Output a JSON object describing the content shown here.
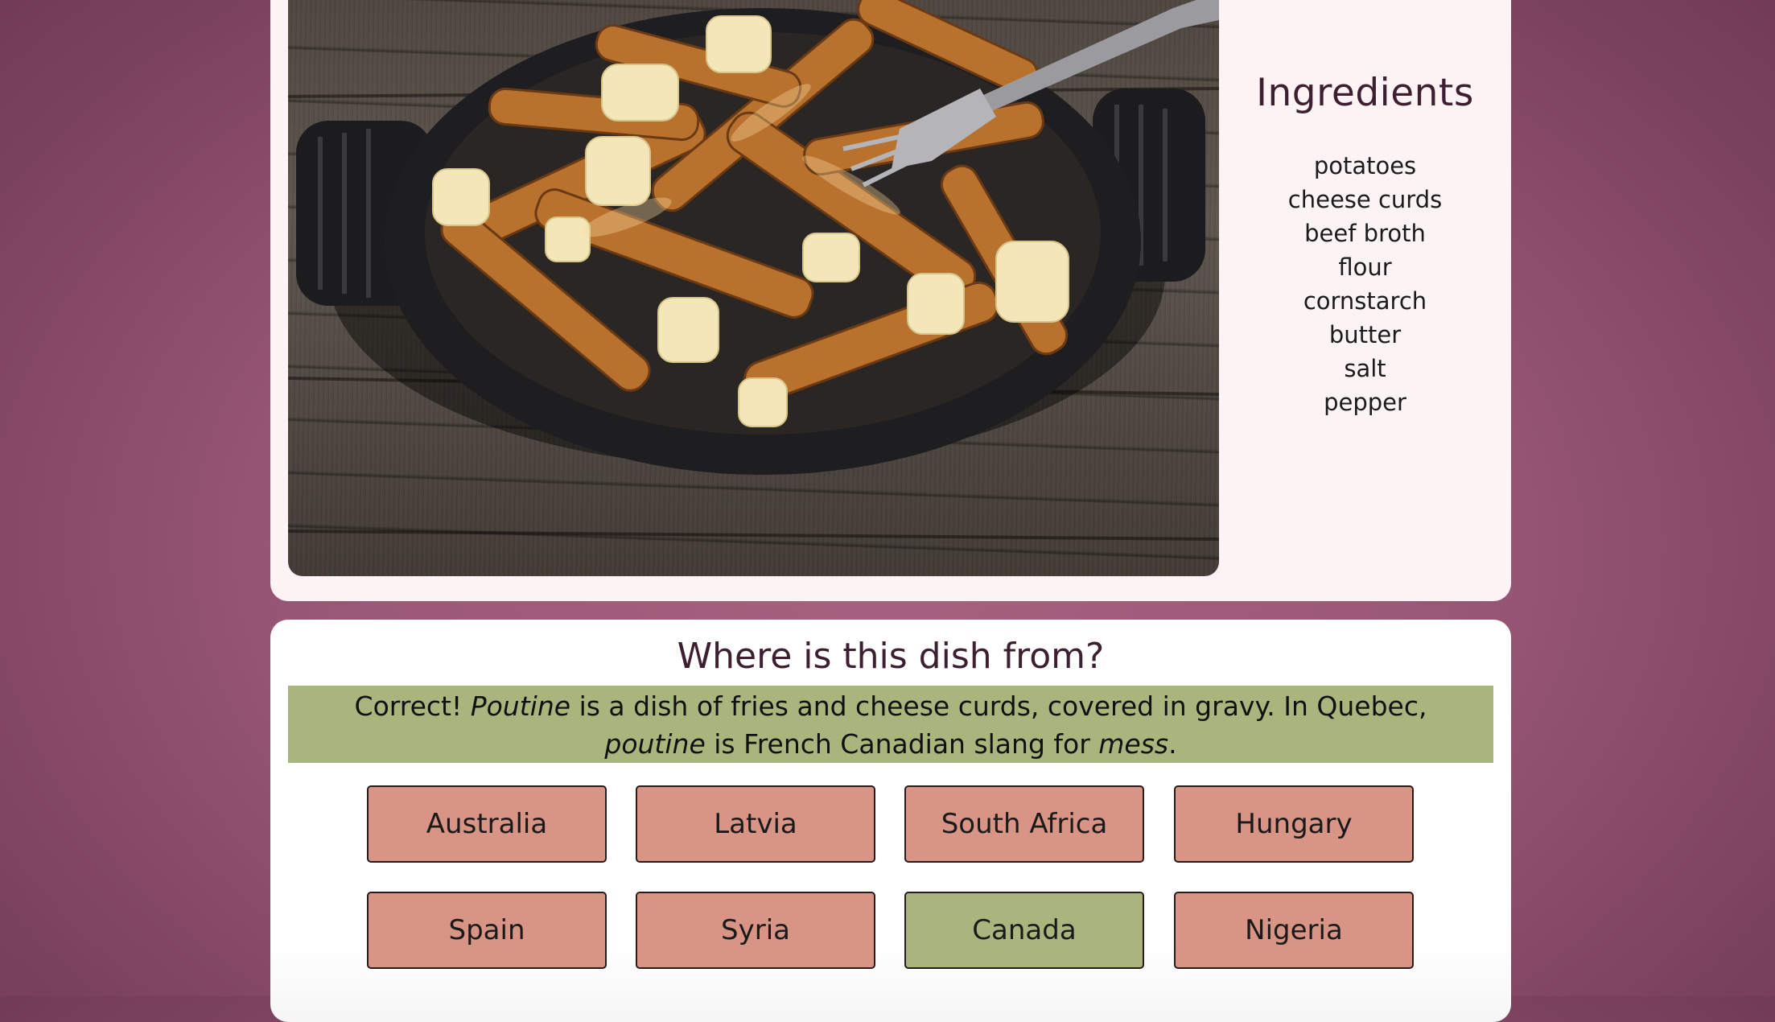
{
  "ingredients": {
    "title": "Ingredients",
    "items": [
      "potatoes",
      "cheese curds",
      "beef broth",
      "flour",
      "cornstarch",
      "butter",
      "salt",
      "pepper"
    ]
  },
  "quiz": {
    "question": "Where is this dish from?",
    "feedback": {
      "correct_label": "Correct!",
      "dish_name": "Poutine",
      "text_1": "is a dish of fries and cheese curds, covered in gravy. In Quebec,",
      "dish_name_lower": "poutine",
      "text_2": "is French Canadian slang for",
      "slang_word": "mess",
      "end": "."
    },
    "answers": [
      {
        "label": "Australia",
        "state": "wrong"
      },
      {
        "label": "Latvia",
        "state": "wrong"
      },
      {
        "label": "South Africa",
        "state": "wrong"
      },
      {
        "label": "Hungary",
        "state": "wrong"
      },
      {
        "label": "Spain",
        "state": "wrong"
      },
      {
        "label": "Syria",
        "state": "wrong"
      },
      {
        "label": "Canada",
        "state": "correct"
      },
      {
        "label": "Nigeria",
        "state": "wrong"
      }
    ]
  },
  "colors": {
    "background": "#9a5877",
    "card": "#fcf3f4",
    "correct": "#a8b67e",
    "wrong": "#d89485",
    "heading": "#3d1f31"
  }
}
